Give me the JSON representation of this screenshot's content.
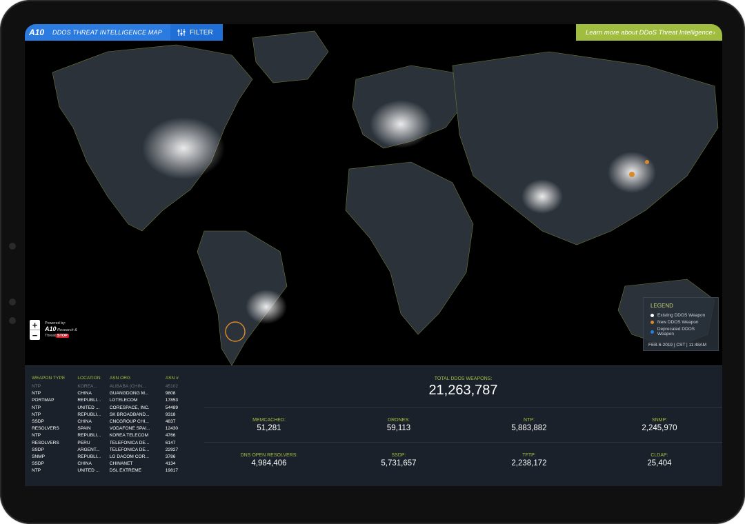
{
  "header": {
    "logo": "A10",
    "title": "DDOS THREAT INTELLIGENCE MAP",
    "filter_label": "FILTER",
    "learn_more": "Learn more about DDoS Threat Intelligence",
    "learn_more_icon": "chevron-right-icon",
    "filter_icon": "sliders-icon"
  },
  "map": {
    "zoom_in": "+",
    "zoom_out": "−",
    "powered_by": "Powered by:",
    "research": "Research &",
    "threat": "Threat",
    "stop": "STOP"
  },
  "legend": {
    "title": "LEGEND",
    "items": [
      {
        "label": "Existing DDOS Weapon",
        "color": "#ffffff"
      },
      {
        "label": "New DDOS Weapon",
        "color": "#d98a2b"
      },
      {
        "label": "Deprecated DDOS Weapon",
        "color": "#2b7be0"
      }
    ],
    "timestamp": "FEB-6-2019 | CST | 11:48AM"
  },
  "weapons_table": {
    "headers": [
      "WEAPON TYPE",
      "LOCATION",
      "ASN ORG",
      "ASN #"
    ],
    "rows": [
      [
        "NTP",
        "KOREA...",
        "ALIBABA (CHIN...",
        "45102"
      ],
      [
        "NTP",
        "CHINA",
        "GUANGDONG M...",
        "9808"
      ],
      [
        "PORTMAP",
        "REPUBLI...",
        "LGTELECOM",
        "17853"
      ],
      [
        "NTP",
        "UNITED ...",
        "CORESPACE, INC.",
        "54489"
      ],
      [
        "NTP",
        "REPUBLI...",
        "SK BROADBAND...",
        "9318"
      ],
      [
        "SSDP",
        "CHINA",
        "CNCGROUP CHI...",
        "4837"
      ],
      [
        "RESOLVERS",
        "SPAIN",
        "VODAFONE SPAI...",
        "12430"
      ],
      [
        "NTP",
        "REPUBLI...",
        "KOREA TELECOM",
        "4766"
      ],
      [
        "RESOLVERS",
        "PERU",
        "TELEFONICA DE...",
        "6147"
      ],
      [
        "SSDP",
        "ARGENT...",
        "TELEFONICA DE...",
        "22927"
      ],
      [
        "SNMP",
        "REPUBLI...",
        "LG DACOM COR...",
        "3786"
      ],
      [
        "SSDP",
        "CHINA",
        "CHINANET",
        "4134"
      ],
      [
        "NTP",
        "UNITED ...",
        "DSL EXTREME",
        "19817"
      ]
    ]
  },
  "totals": {
    "label": "TOTAL DDOS WEAPONS:",
    "value": "21,263,787",
    "stats": [
      {
        "label": "MEMCACHED:",
        "value": "51,281"
      },
      {
        "label": "DRONES:",
        "value": "59,113"
      },
      {
        "label": "NTP:",
        "value": "5,883,882"
      },
      {
        "label": "SNMP:",
        "value": "2,245,970"
      },
      {
        "label": "DNS OPEN RESOLVERS:",
        "value": "4,984,406"
      },
      {
        "label": "SSDP:",
        "value": "5,731,657"
      },
      {
        "label": "TFTP:",
        "value": "2,238,172"
      },
      {
        "label": "CLDAP:",
        "value": "25,404"
      }
    ]
  }
}
